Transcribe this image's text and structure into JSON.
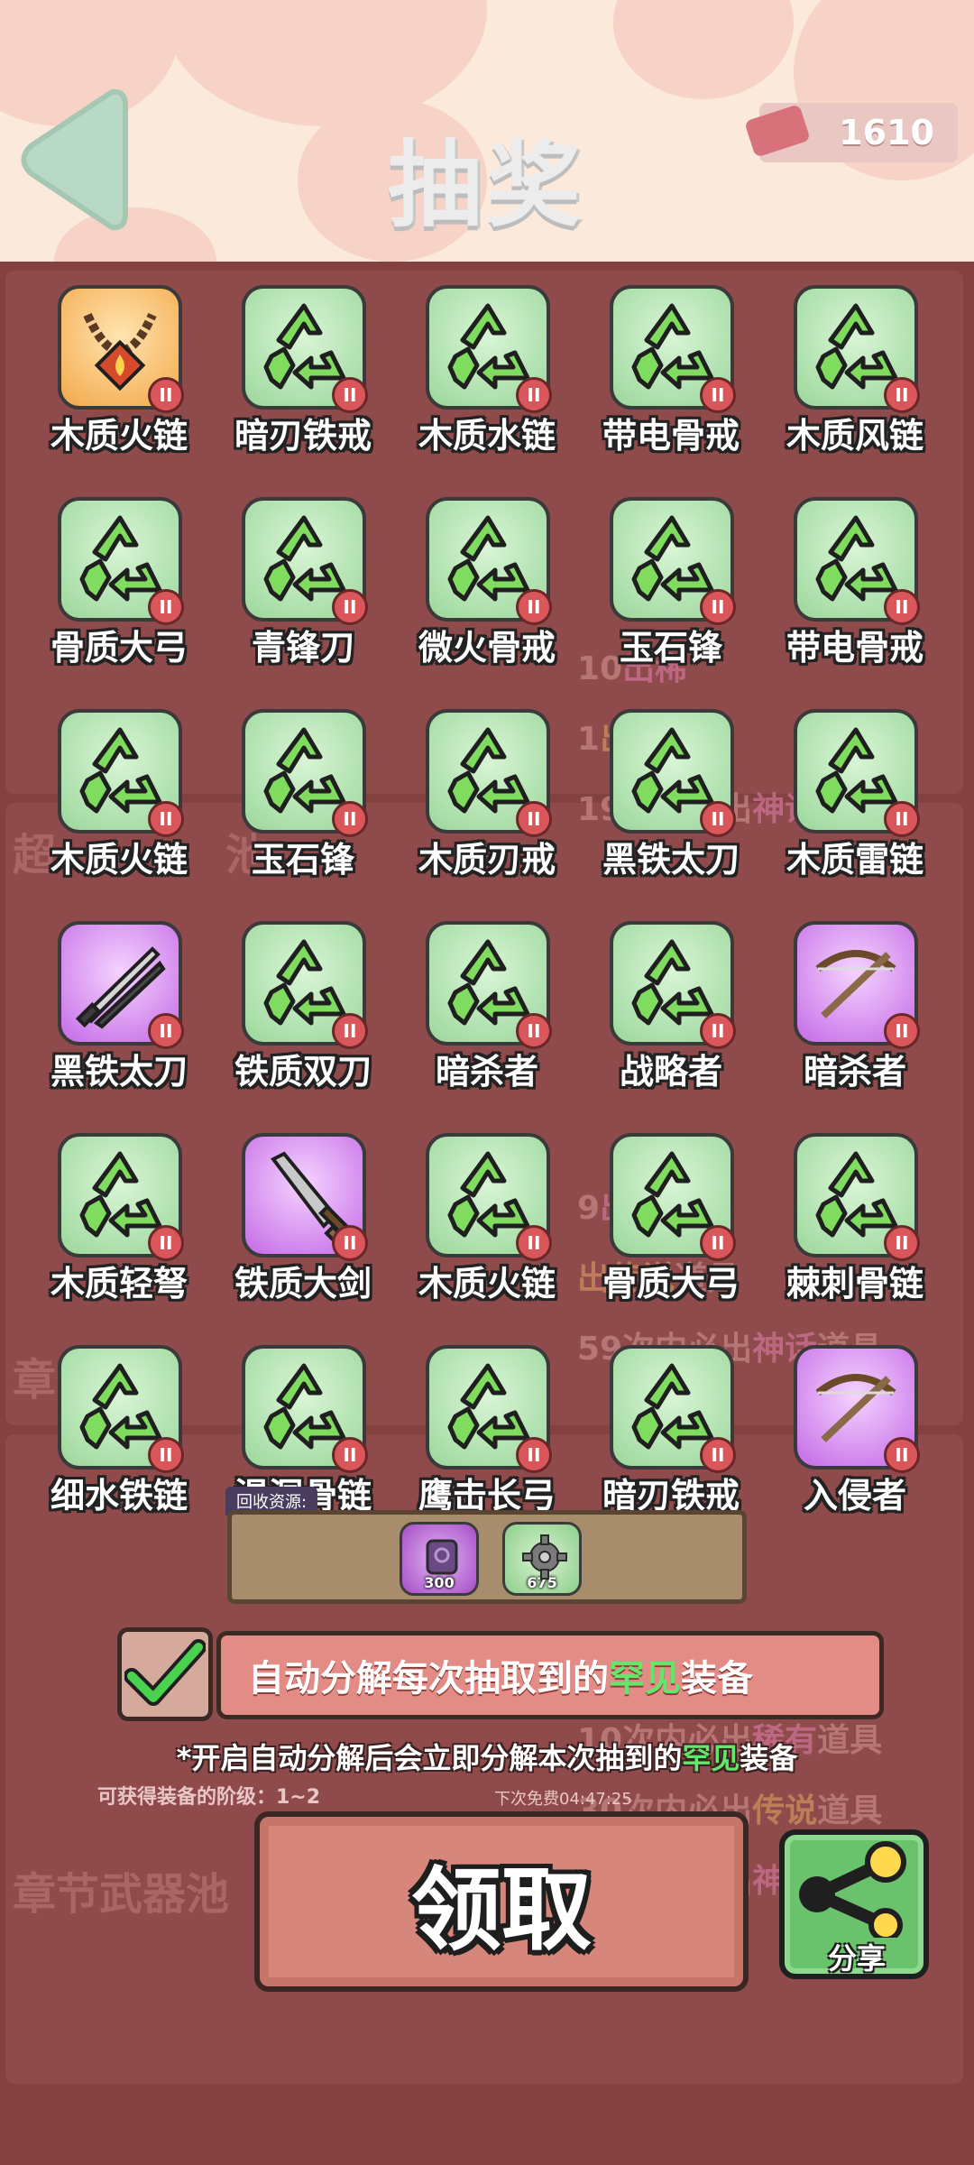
{
  "header": {
    "title": "抽奖",
    "currency_value": "1610"
  },
  "colors": {
    "rare_green": "#64e66a",
    "tile_green": "#9bd79b",
    "tile_orange": "#f3a84a",
    "tile_purple": "#c46ae6",
    "badge_red": "#d9575a"
  },
  "rewards": [
    {
      "label": "木质火链",
      "rarity": "orange",
      "icon": "necklace-icon"
    },
    {
      "label": "暗刃铁戒",
      "rarity": "green",
      "icon": "recycle-icon"
    },
    {
      "label": "木质水链",
      "rarity": "green",
      "icon": "recycle-icon"
    },
    {
      "label": "带电骨戒",
      "rarity": "green",
      "icon": "recycle-icon"
    },
    {
      "label": "木质风链",
      "rarity": "green",
      "icon": "recycle-icon"
    },
    {
      "label": "骨质大弓",
      "rarity": "green",
      "icon": "recycle-icon"
    },
    {
      "label": "青锋刀",
      "rarity": "green",
      "icon": "recycle-icon"
    },
    {
      "label": "微火骨戒",
      "rarity": "green",
      "icon": "recycle-icon"
    },
    {
      "label": "玉石锋",
      "rarity": "green",
      "icon": "recycle-icon"
    },
    {
      "label": "带电骨戒",
      "rarity": "green",
      "icon": "recycle-icon"
    },
    {
      "label": "木质火链",
      "rarity": "green",
      "icon": "recycle-icon"
    },
    {
      "label": "玉石锋",
      "rarity": "green",
      "icon": "recycle-icon"
    },
    {
      "label": "木质刃戒",
      "rarity": "green",
      "icon": "recycle-icon"
    },
    {
      "label": "黑铁太刀",
      "rarity": "green",
      "icon": "recycle-icon"
    },
    {
      "label": "木质雷链",
      "rarity": "green",
      "icon": "recycle-icon"
    },
    {
      "label": "黑铁太刀",
      "rarity": "purple",
      "icon": "katana-icon"
    },
    {
      "label": "铁质双刀",
      "rarity": "green",
      "icon": "recycle-icon"
    },
    {
      "label": "暗杀者",
      "rarity": "green",
      "icon": "recycle-icon"
    },
    {
      "label": "战略者",
      "rarity": "green",
      "icon": "recycle-icon"
    },
    {
      "label": "暗杀者",
      "rarity": "purple",
      "icon": "crossbow-icon"
    },
    {
      "label": "木质轻弩",
      "rarity": "green",
      "icon": "recycle-icon"
    },
    {
      "label": "铁质大剑",
      "rarity": "purple",
      "icon": "sword-icon"
    },
    {
      "label": "木质火链",
      "rarity": "green",
      "icon": "recycle-icon"
    },
    {
      "label": "骨质大弓",
      "rarity": "green",
      "icon": "recycle-icon"
    },
    {
      "label": "棘刺骨链",
      "rarity": "green",
      "icon": "recycle-icon"
    },
    {
      "label": "细水铁链",
      "rarity": "green",
      "icon": "recycle-icon"
    },
    {
      "label": "渴洞骨链",
      "rarity": "green",
      "icon": "recycle-icon"
    },
    {
      "label": "鹰击长弓",
      "rarity": "green",
      "icon": "recycle-icon"
    },
    {
      "label": "暗刃铁戒",
      "rarity": "green",
      "icon": "recycle-icon"
    },
    {
      "label": "入侵者",
      "rarity": "purple",
      "icon": "crossbow-icon"
    }
  ],
  "badge_text": "II",
  "recycle": {
    "label": "回收资源:",
    "items": [
      {
        "value": "300",
        "icon": "purple-stone-icon"
      },
      {
        "value": "675",
        "icon": "gear-icon"
      }
    ]
  },
  "auto_decompose": {
    "checked": true,
    "text_before": "自动分解每次抽取到的",
    "text_highlight": "罕见",
    "text_after": "装备",
    "note_before": "*开启自动分解后会立即分解本次抽到的",
    "note_highlight": "罕见",
    "note_after": "装备"
  },
  "stage_note": "可获得装备的阶级：1~2",
  "free_note": "下次免费04:47:25",
  "claim_label": "领取",
  "share_label": "分享",
  "background": {
    "section_1": "超",
    "section_1_tail": "池",
    "section_2": "章",
    "section_3": "章节武器池",
    "lines_1": [
      {
        "pre": "10",
        "hl": "出稀",
        "post": "",
        "hl_class": "hl-rare"
      },
      {
        "pre": "1",
        "hl": "出传",
        "post": "",
        "hl_class": "hl-leg"
      },
      {
        "pre": "19次内必出",
        "hl": "神话",
        "post": "道具",
        "hl_class": "hl-myth"
      }
    ],
    "lines_2": [
      {
        "pre": "9",
        "hl": "出稀",
        "post": "",
        "hl_class": "hl-rare"
      },
      {
        "pre": "",
        "hl": "出传说",
        "post": "道具",
        "hl_class": "hl-leg"
      },
      {
        "pre": "59次内必出",
        "hl": "神话",
        "post": "道具",
        "hl_class": "hl-myth"
      }
    ],
    "lines_3": [
      {
        "pre": "10次内必出",
        "hl": "稀有",
        "post": "道具",
        "hl_class": "hl-rare"
      },
      {
        "pre": "30次内必出",
        "hl": "传说",
        "post": "道具",
        "hl_class": "hl-leg"
      },
      {
        "pre": "60次内必出",
        "hl": "神话",
        "post": "道具",
        "hl_class": "hl-myth"
      }
    ]
  }
}
